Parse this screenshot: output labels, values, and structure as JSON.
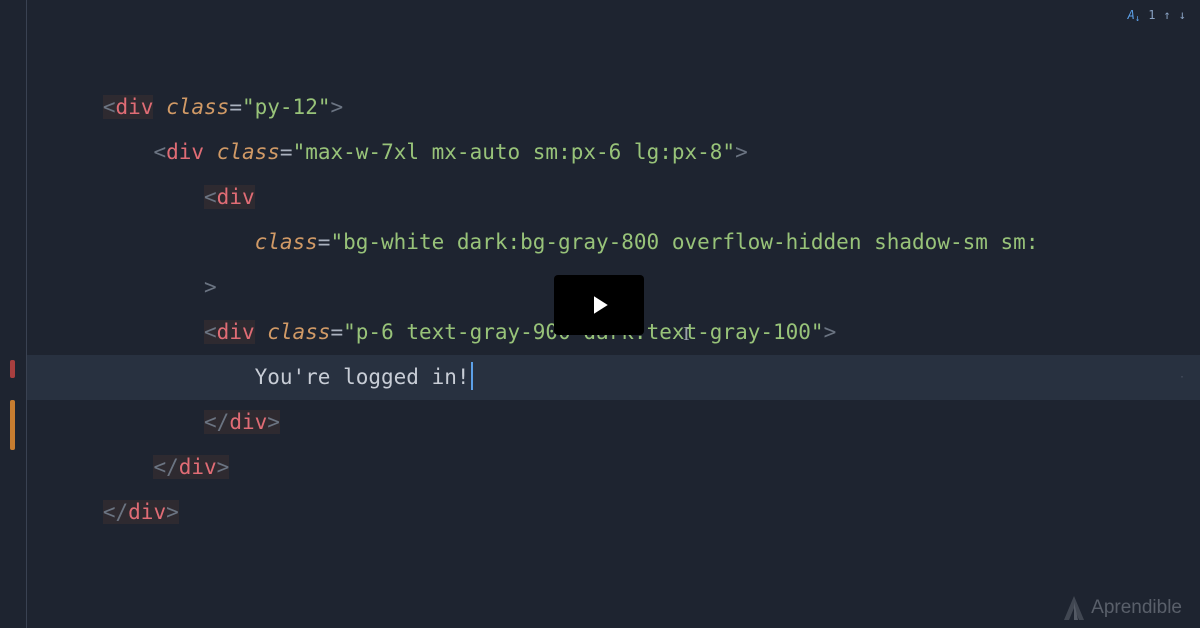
{
  "topControls": {
    "matchCount": "1",
    "upGlyph": "↑",
    "downGlyph": "↓"
  },
  "code": {
    "line1": {
      "tag": "div",
      "attrName": "class",
      "attrValue": "\"py-12\""
    },
    "line2": {
      "tag": "div",
      "attrName": "class",
      "attrValue": "\"max-w-7xl mx-auto sm:px-6 lg:px-8\""
    },
    "line3": {
      "tag": "div"
    },
    "line4": {
      "attrName": "class",
      "attrValue": "\"bg-white dark:bg-gray-800 overflow-hidden shadow-sm sm:"
    },
    "line5": {
      "closeAngle": ">"
    },
    "line6": {
      "tag": "div",
      "attrName": "class",
      "attrValue": "\"p-6 text-gray-900 dark:text-gray-100\""
    },
    "line7": {
      "text": "You're logged in!"
    },
    "line8": {
      "closeTag": "div"
    },
    "line9": {
      "closeTag": "div"
    },
    "line10": {
      "closeTag": "div"
    }
  },
  "watermark": {
    "brand": "Aprendible"
  }
}
